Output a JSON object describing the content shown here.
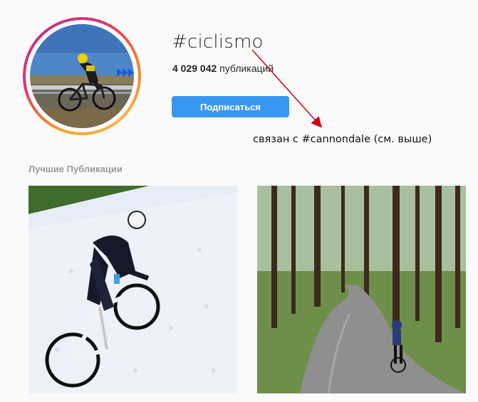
{
  "hashtag": {
    "title": "#ciclismo",
    "post_count": "4 029 042",
    "post_count_suffix": " публикаций",
    "follow_label": "Подписаться"
  },
  "annotation": {
    "text": "связан с #cannondale (см. выше)",
    "arrow_color": "#d0021b"
  },
  "top_posts": {
    "heading": "Лучшие Публикации"
  },
  "colors": {
    "accent": "#3897f0",
    "ring_start": "#f58529",
    "ring_end": "#c13584"
  }
}
